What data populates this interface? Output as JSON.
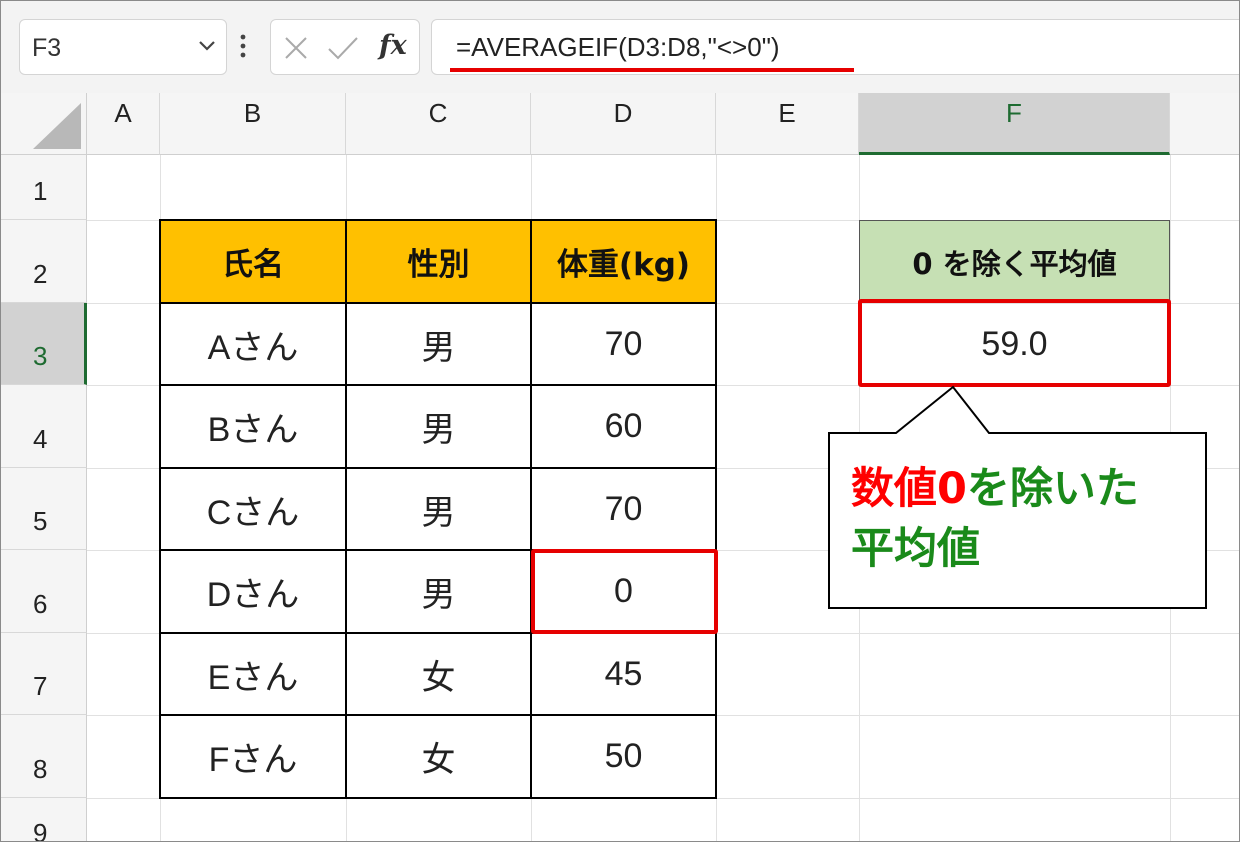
{
  "formula_bar": {
    "name_box": "F3",
    "fx_label": "fx",
    "formula": "=AVERAGEIF(D3:D8,\"<>0\")"
  },
  "columns": [
    "A",
    "B",
    "C",
    "D",
    "E",
    "F"
  ],
  "rows": [
    "1",
    "2",
    "3",
    "4",
    "5",
    "6",
    "7",
    "8",
    "9"
  ],
  "table": {
    "headers": [
      "氏名",
      "性別",
      "体重(kg)"
    ],
    "rows": [
      [
        "Aさん",
        "男",
        "70"
      ],
      [
        "Bさん",
        "男",
        "60"
      ],
      [
        "Cさん",
        "男",
        "70"
      ],
      [
        "Dさん",
        "男",
        "0"
      ],
      [
        "Eさん",
        "女",
        "45"
      ],
      [
        "Fさん",
        "女",
        "50"
      ]
    ]
  },
  "result": {
    "header": "0 を除く平均値",
    "value": "59.0"
  },
  "callout": {
    "line1_red": "数値0",
    "line1_green": "を除いた",
    "line2_green": "平均値"
  },
  "colors": {
    "table_header": "#ffc000",
    "result_header": "#c6e0b4",
    "highlight": "#e60000",
    "selected_header_text": "#1e6b31"
  }
}
